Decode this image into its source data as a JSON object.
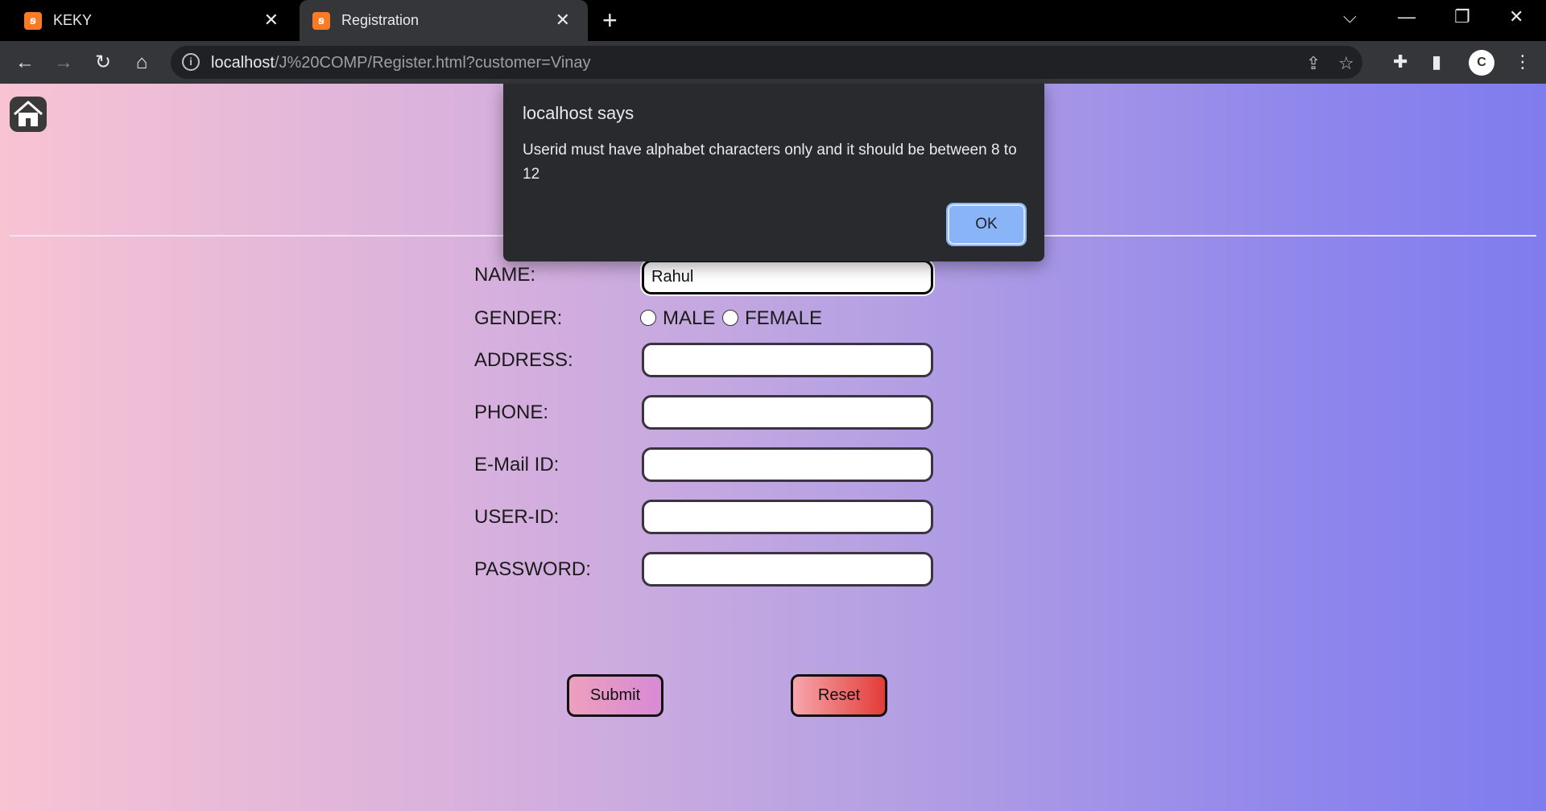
{
  "browser": {
    "tabs": [
      {
        "title": "KEKY",
        "active": false
      },
      {
        "title": "Registration",
        "active": true
      }
    ],
    "url_host": "localhost",
    "url_path": "/J%20COMP/Register.html?customer=Vinay"
  },
  "form": {
    "name_label": "NAME:",
    "name_value": "Rahul",
    "gender_label": "GENDER:",
    "gender_options": [
      "MALE",
      "FEMALE"
    ],
    "address_label": "ADDRESS:",
    "phone_label": "PHONE:",
    "email_label": "E-Mail ID:",
    "userid_label": "USER-ID:",
    "password_label": "PASSWORD:",
    "submit_label": "Submit",
    "reset_label": "Reset"
  },
  "alert": {
    "title": "localhost says",
    "message": "Userid must have alphabet characters only and it should be between 8 to 12",
    "ok_label": "OK"
  },
  "colors": {
    "gradient_left": "#f8c3d3",
    "gradient_right": "#7f7cee",
    "dialog_bg": "#292a2d",
    "ok_button": "#8ab4f8"
  }
}
